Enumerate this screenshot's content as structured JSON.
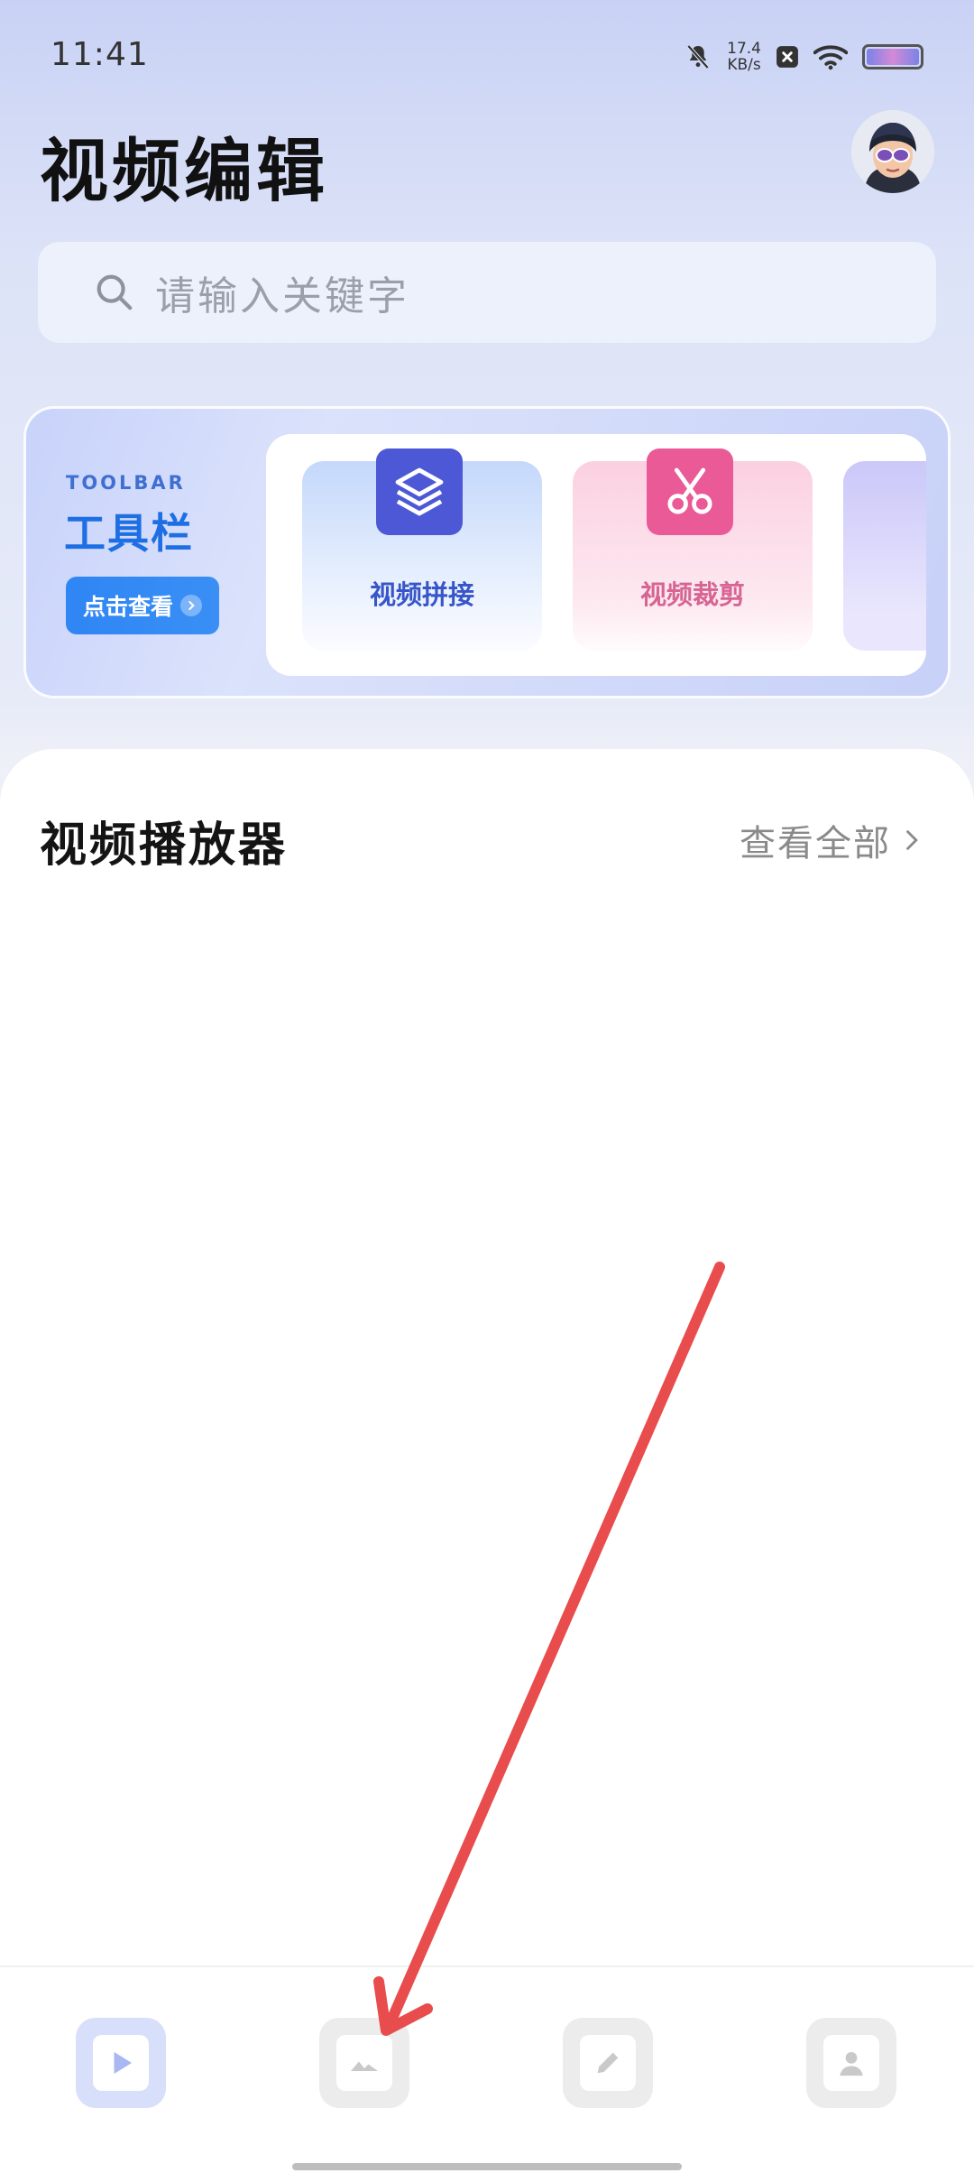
{
  "status_bar": {
    "time": "11:41",
    "net_speed_value": "17.4",
    "net_speed_unit": "KB/s",
    "icons": [
      "bell-muted-icon",
      "close-box-icon",
      "wifi-icon",
      "battery-icon"
    ]
  },
  "header": {
    "title": "视频编辑",
    "avatar": "avatar"
  },
  "search": {
    "placeholder": "请输入关键字",
    "icon": "search-icon"
  },
  "toolbar": {
    "eyebrow": "TOOLBAR",
    "title": "工具栏",
    "button_label": "点击查看",
    "tools": [
      {
        "label": "视频拼接",
        "icon": "layers-icon",
        "color": "#4d58d6"
      },
      {
        "label": "视频裁剪",
        "icon": "scissors-icon",
        "color": "#ea5a97"
      }
    ]
  },
  "section": {
    "title": "视频播放器",
    "view_all": "查看全部"
  },
  "bottom_nav": {
    "items": [
      {
        "icon": "play-icon",
        "active": true
      },
      {
        "icon": "image-icon",
        "active": false
      },
      {
        "icon": "pencil-icon",
        "active": false
      },
      {
        "icon": "profile-icon",
        "active": false
      }
    ]
  },
  "colors": {
    "accent": "#1f6fe4",
    "annotation_arrow": "#e84c4c"
  }
}
